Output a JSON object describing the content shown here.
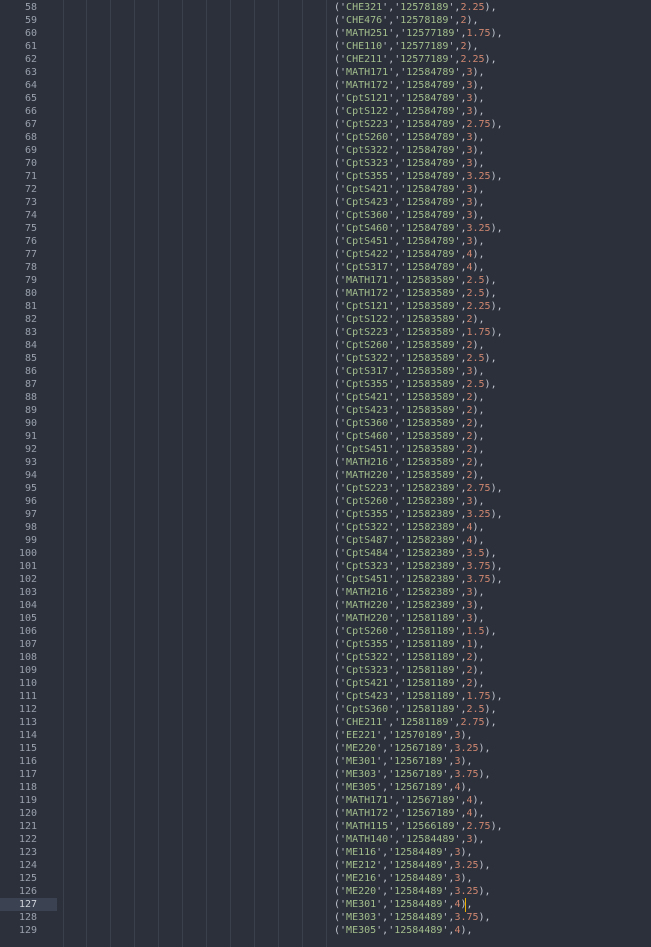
{
  "editor": {
    "current_line": 127,
    "lines": [
      {
        "n": "58",
        "course": "CHE321",
        "id": "12578189",
        "grade": "2.25"
      },
      {
        "n": "59",
        "course": "CHE476",
        "id": "12578189",
        "grade": "2"
      },
      {
        "n": "60",
        "course": "MATH251",
        "id": "12577189",
        "grade": "1.75"
      },
      {
        "n": "61",
        "course": "CHE110",
        "id": "12577189",
        "grade": "2"
      },
      {
        "n": "62",
        "course": "CHE211",
        "id": "12577189",
        "grade": "2.25"
      },
      {
        "n": "63",
        "course": "MATH171",
        "id": "12584789",
        "grade": "3"
      },
      {
        "n": "64",
        "course": "MATH172",
        "id": "12584789",
        "grade": "3"
      },
      {
        "n": "65",
        "course": "CptS121",
        "id": "12584789",
        "grade": "3"
      },
      {
        "n": "66",
        "course": "CptS122",
        "id": "12584789",
        "grade": "3"
      },
      {
        "n": "67",
        "course": "CptS223",
        "id": "12584789",
        "grade": "2.75"
      },
      {
        "n": "68",
        "course": "CptS260",
        "id": "12584789",
        "grade": "3"
      },
      {
        "n": "69",
        "course": "CptS322",
        "id": "12584789",
        "grade": "3"
      },
      {
        "n": "70",
        "course": "CptS323",
        "id": "12584789",
        "grade": "3"
      },
      {
        "n": "71",
        "course": "CptS355",
        "id": "12584789",
        "grade": "3.25"
      },
      {
        "n": "72",
        "course": "CptS421",
        "id": "12584789",
        "grade": "3"
      },
      {
        "n": "73",
        "course": "CptS423",
        "id": "12584789",
        "grade": "3"
      },
      {
        "n": "74",
        "course": "CptS360",
        "id": "12584789",
        "grade": "3"
      },
      {
        "n": "75",
        "course": "CptS460",
        "id": "12584789",
        "grade": "3.25"
      },
      {
        "n": "76",
        "course": "CptS451",
        "id": "12584789",
        "grade": "3"
      },
      {
        "n": "77",
        "course": "CptS422",
        "id": "12584789",
        "grade": "4"
      },
      {
        "n": "78",
        "course": "CptS317",
        "id": "12584789",
        "grade": "4"
      },
      {
        "n": "79",
        "course": "MATH171",
        "id": "12583589",
        "grade": "2.5"
      },
      {
        "n": "80",
        "course": "MATH172",
        "id": "12583589",
        "grade": "2.5"
      },
      {
        "n": "81",
        "course": "CptS121",
        "id": "12583589",
        "grade": "2.25"
      },
      {
        "n": "82",
        "course": "CptS122",
        "id": "12583589",
        "grade": "2"
      },
      {
        "n": "83",
        "course": "CptS223",
        "id": "12583589",
        "grade": "1.75"
      },
      {
        "n": "84",
        "course": "CptS260",
        "id": "12583589",
        "grade": "2"
      },
      {
        "n": "85",
        "course": "CptS322",
        "id": "12583589",
        "grade": "2.5"
      },
      {
        "n": "86",
        "course": "CptS317",
        "id": "12583589",
        "grade": "3"
      },
      {
        "n": "87",
        "course": "CptS355",
        "id": "12583589",
        "grade": "2.5"
      },
      {
        "n": "88",
        "course": "CptS421",
        "id": "12583589",
        "grade": "2"
      },
      {
        "n": "89",
        "course": "CptS423",
        "id": "12583589",
        "grade": "2"
      },
      {
        "n": "90",
        "course": "CptS360",
        "id": "12583589",
        "grade": "2"
      },
      {
        "n": "91",
        "course": "CptS460",
        "id": "12583589",
        "grade": "2"
      },
      {
        "n": "92",
        "course": "CptS451",
        "id": "12583589",
        "grade": "2"
      },
      {
        "n": "93",
        "course": "MATH216",
        "id": "12583589",
        "grade": "2"
      },
      {
        "n": "94",
        "course": "MATH220",
        "id": "12583589",
        "grade": "2"
      },
      {
        "n": "95",
        "course": "CptS223",
        "id": "12582389",
        "grade": "2.75"
      },
      {
        "n": "96",
        "course": "CptS260",
        "id": "12582389",
        "grade": "3"
      },
      {
        "n": "97",
        "course": "CptS355",
        "id": "12582389",
        "grade": "3.25"
      },
      {
        "n": "98",
        "course": "CptS322",
        "id": "12582389",
        "grade": "4"
      },
      {
        "n": "99",
        "course": "CptS487",
        "id": "12582389",
        "grade": "4"
      },
      {
        "n": "100",
        "course": "CptS484",
        "id": "12582389",
        "grade": "3.5"
      },
      {
        "n": "101",
        "course": "CptS323",
        "id": "12582389",
        "grade": "3.75"
      },
      {
        "n": "102",
        "course": "CptS451",
        "id": "12582389",
        "grade": "3.75"
      },
      {
        "n": "103",
        "course": "MATH216",
        "id": "12582389",
        "grade": "3"
      },
      {
        "n": "104",
        "course": "MATH220",
        "id": "12582389",
        "grade": "3"
      },
      {
        "n": "105",
        "course": "MATH220",
        "id": "12581189",
        "grade": "3"
      },
      {
        "n": "106",
        "course": "CptS260",
        "id": "12581189",
        "grade": "1.5"
      },
      {
        "n": "107",
        "course": "CptS355",
        "id": "12581189",
        "grade": "1"
      },
      {
        "n": "108",
        "course": "CptS322",
        "id": "12581189",
        "grade": "2"
      },
      {
        "n": "109",
        "course": "CptS323",
        "id": "12581189",
        "grade": "2"
      },
      {
        "n": "110",
        "course": "CptS421",
        "id": "12581189",
        "grade": "2"
      },
      {
        "n": "111",
        "course": "CptS423",
        "id": "12581189",
        "grade": "1.75"
      },
      {
        "n": "112",
        "course": "CptS360",
        "id": "12581189",
        "grade": "2.5"
      },
      {
        "n": "113",
        "course": "CHE211",
        "id": "12581189",
        "grade": "2.75"
      },
      {
        "n": "114",
        "course": "EE221",
        "id": "12570189",
        "grade": "3"
      },
      {
        "n": "115",
        "course": "ME220",
        "id": "12567189",
        "grade": "3.25"
      },
      {
        "n": "116",
        "course": "ME301",
        "id": "12567189",
        "grade": "3"
      },
      {
        "n": "117",
        "course": "ME303",
        "id": "12567189",
        "grade": "3.75"
      },
      {
        "n": "118",
        "course": "ME305",
        "id": "12567189",
        "grade": "4"
      },
      {
        "n": "119",
        "course": "MATH171",
        "id": "12567189",
        "grade": "4"
      },
      {
        "n": "120",
        "course": "MATH172",
        "id": "12567189",
        "grade": "4"
      },
      {
        "n": "121",
        "course": "MATH115",
        "id": "12566189",
        "grade": "2.75"
      },
      {
        "n": "122",
        "course": "MATH140",
        "id": "12584489",
        "grade": "3"
      },
      {
        "n": "123",
        "course": "ME116",
        "id": "12584489",
        "grade": "3"
      },
      {
        "n": "124",
        "course": "ME212",
        "id": "12584489",
        "grade": "3.25"
      },
      {
        "n": "125",
        "course": "ME216",
        "id": "12584489",
        "grade": "3"
      },
      {
        "n": "126",
        "course": "ME220",
        "id": "12584489",
        "grade": "3.25"
      },
      {
        "n": "127",
        "course": "ME301",
        "id": "12584489",
        "grade": "4"
      },
      {
        "n": "128",
        "course": "ME303",
        "id": "12584489",
        "grade": "3.75"
      },
      {
        "n": "129",
        "course": "ME305",
        "id": "12584489",
        "grade": "4"
      }
    ]
  }
}
